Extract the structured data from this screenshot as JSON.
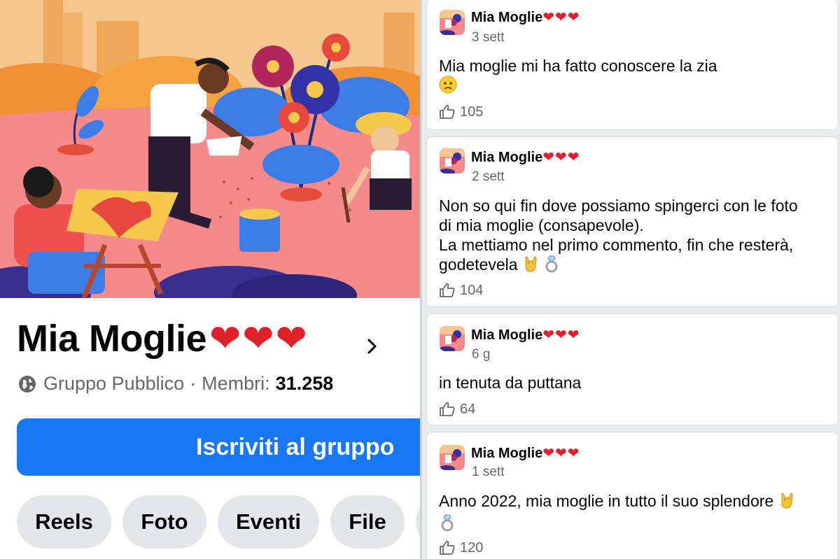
{
  "group": {
    "name": "Mia Moglie",
    "name_hearts": "❤❤❤",
    "visibility": "Gruppo Pubblico",
    "separator": "·",
    "members_label": "Membri:",
    "members_count": "31.258",
    "join_label": "Iscriviti al gruppo",
    "tabs": [
      {
        "label": "Reels"
      },
      {
        "label": "Foto"
      },
      {
        "label": "Eventi"
      },
      {
        "label": "File"
      }
    ]
  },
  "posts": [
    {
      "author": "Mia Moglie",
      "hearts": "❤❤❤",
      "time": "3 sett",
      "text": "Mia moglie mi ha fatto conoscere la zia",
      "likes": "105"
    },
    {
      "author": "Mia Moglie",
      "hearts": "❤❤❤",
      "time": "2 sett",
      "text": "Non so qui fin dove possiamo spingerci con le foto\ndi mia moglie (consapevole).\nLa mettiamo nel primo commento, fin che resterà,\ngodetevela",
      "likes": "104"
    },
    {
      "author": "Mia Moglie",
      "hearts": "❤❤❤",
      "time": "6 g",
      "text": "in tenuta da puttana",
      "likes": "64"
    },
    {
      "author": "Mia Moglie",
      "hearts": "❤❤❤",
      "time": "1 sett",
      "text": "Anno 2022, mia moglie in tutto il suo splendore",
      "likes": "120"
    }
  ],
  "icons": {
    "globe": "globe-icon",
    "chevron": "chevron-right-icon",
    "like": "thumbs-up-icon",
    "worried": "worried-face-icon",
    "rock": "rock-on-hand-icon",
    "ring": "ring-icon"
  },
  "colors": {
    "primary": "#1877f2",
    "heart": "#e0202a",
    "muted": "#65676b",
    "pill_bg": "#e4e6eb",
    "feed_bg": "#e9ebee"
  }
}
